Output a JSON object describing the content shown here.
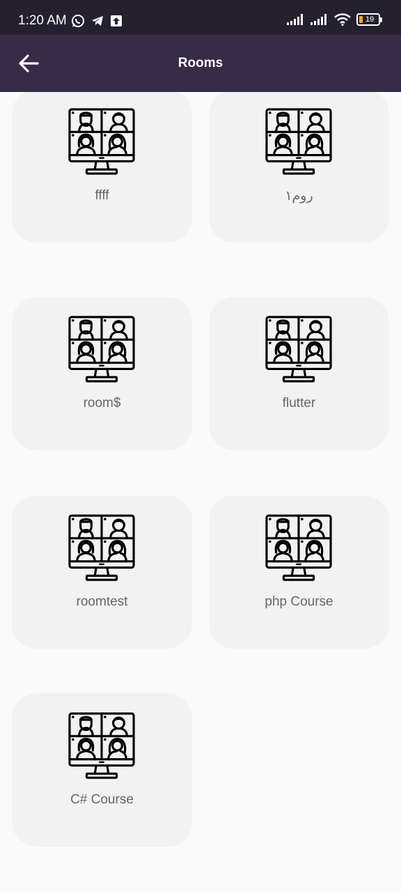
{
  "status_bar": {
    "time": "1:20 AM",
    "battery_level": "19",
    "left_icons": [
      "whatsapp-icon",
      "telegram-icon",
      "upload-icon"
    ],
    "right_icons": [
      "signal-icon",
      "signal-icon",
      "wifi-icon",
      "battery-icon"
    ]
  },
  "app_bar": {
    "title": "Rooms",
    "back_icon": "arrow-left-icon"
  },
  "rooms": [
    {
      "name": "ffff",
      "icon": "video-conference-icon"
    },
    {
      "name": "روم١",
      "icon": "video-conference-icon"
    },
    {
      "name": "room$",
      "icon": "video-conference-icon"
    },
    {
      "name": "flutter",
      "icon": "video-conference-icon"
    },
    {
      "name": "roomtest",
      "icon": "video-conference-icon"
    },
    {
      "name": "php Course",
      "icon": "video-conference-icon"
    },
    {
      "name": "C# Course",
      "icon": "video-conference-icon"
    }
  ],
  "colors": {
    "status_bar": "#24202f",
    "app_bar": "#372b48",
    "card": "#f2f2f2",
    "background": "#fafafa",
    "battery_accent": "#f5a623"
  }
}
